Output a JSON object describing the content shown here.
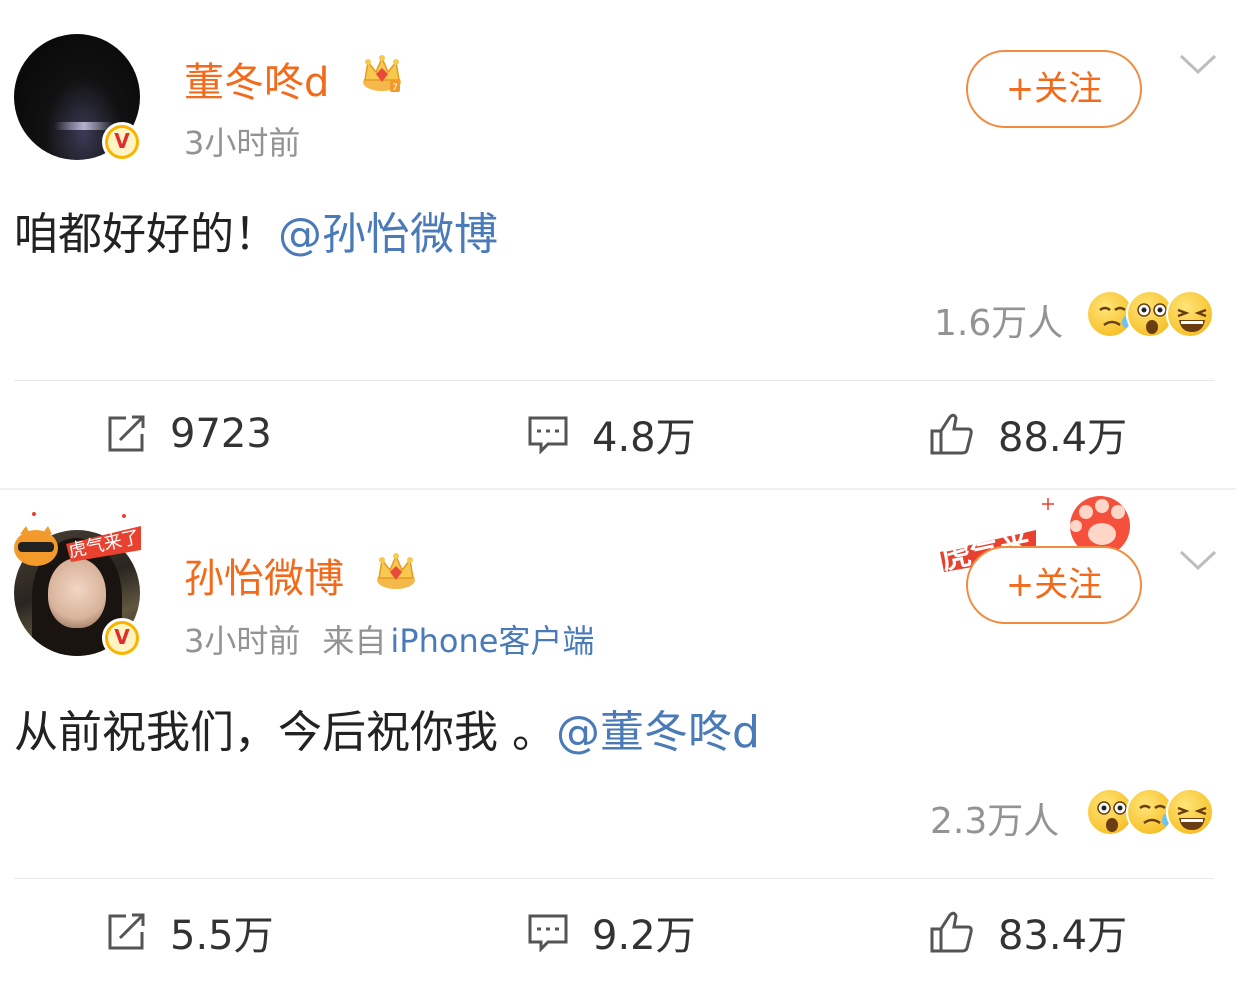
{
  "posts": [
    {
      "username": "董冬咚d",
      "time": "3小时前",
      "source_label": "",
      "source_client": "",
      "follow_label": "+关注",
      "text": "咱都好好的！",
      "mention": "@孙怡微博",
      "reaction_count": "1.6万人",
      "reactions": [
        "tearful-grin-emoji",
        "shocked-emoji",
        "laughing-emoji"
      ],
      "reposts": "9723",
      "comments": "4.8万",
      "likes": "88.4万"
    },
    {
      "username": "孙怡微博",
      "time": "3小时前",
      "source_label": "来自",
      "source_client": "iPhone客户端",
      "follow_label": "+关注",
      "text": "从前祝我们，今后祝你我 。",
      "mention": "@董冬咚d",
      "reaction_count": "2.3万人",
      "reactions": [
        "shocked-emoji",
        "tearful-grin-emoji",
        "laughing-emoji"
      ],
      "reposts": "5.5万",
      "comments": "9.2万",
      "likes": "83.4万"
    }
  ],
  "colors": {
    "username": "#f26a1b",
    "mention": "#4a7ab8",
    "meta": "#939393",
    "verified_badge": "#f7b500"
  }
}
